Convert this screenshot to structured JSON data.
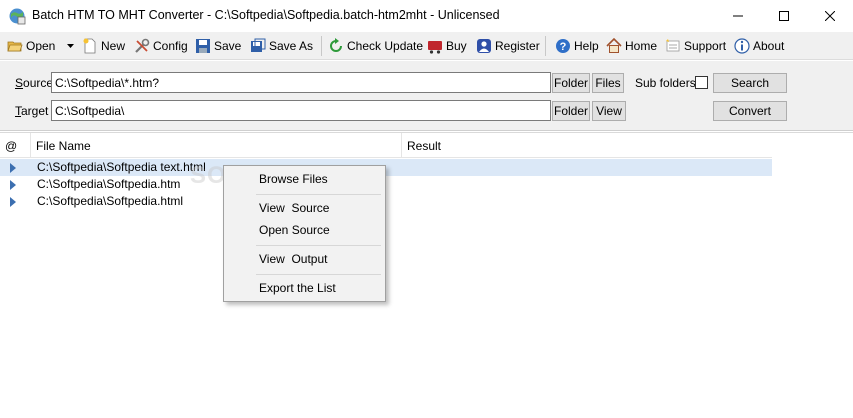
{
  "window": {
    "title": "Batch HTM TO MHT Converter - C:\\Softpedia\\Softpedia.batch-htm2mht - Unlicensed"
  },
  "toolbar": {
    "open": "Open",
    "new": "New",
    "config": "Config",
    "save": "Save",
    "save_as": "Save As",
    "check_update": "Check Update",
    "buy": "Buy",
    "register": "Register",
    "help": "Help",
    "home": "Home",
    "support": "Support",
    "about": "About"
  },
  "paths": {
    "source_label_first": "S",
    "source_label_rest": "ource",
    "source_value": "C:\\Softpedia\\*.htm?",
    "target_label_first": "T",
    "target_label_rest": "arget",
    "target_value": "C:\\Softpedia\\",
    "folder_button": "Folder",
    "files_button": "Files",
    "view_button": "View",
    "subfolders_label": "Sub folders",
    "subfolders_checked": false,
    "search_button": "Search",
    "convert_button": "Convert"
  },
  "list": {
    "columns": [
      "@",
      "File Name",
      "Result"
    ],
    "rows": [
      {
        "file": "C:\\Softpedia\\Softpedia text.html",
        "result": "",
        "selected": true
      },
      {
        "file": "C:\\Softpedia\\Softpedia.htm",
        "result": "",
        "selected": false
      },
      {
        "file": "C:\\Softpedia\\Softpedia.html",
        "result": "",
        "selected": false
      }
    ]
  },
  "context_menu": {
    "items": [
      "Browse Files",
      "View  Source",
      "Open Source",
      "View  Output",
      "Export the List"
    ]
  },
  "watermark": "SOFTPEDIA",
  "colors": {
    "toolbar_bg": "#f0f0f0",
    "selection": "#dbe8f7",
    "row_marker": "#3c6fb0"
  }
}
